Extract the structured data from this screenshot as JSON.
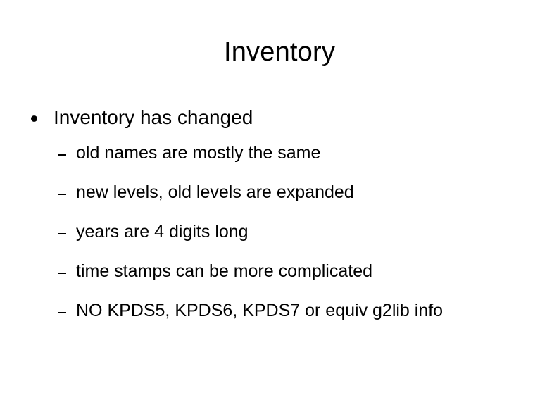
{
  "slide": {
    "title": "Inventory",
    "background_color": "#ffffff",
    "text_color": "#000000",
    "bullets": [
      {
        "marker": "disc-bullet-icon",
        "text": "Inventory has changed",
        "children": [
          {
            "marker": "dash-bullet-icon",
            "text": "old names are mostly the same"
          },
          {
            "marker": "dash-bullet-icon",
            "text": "new levels, old levels are expanded"
          },
          {
            "marker": "dash-bullet-icon",
            "text": "years are 4 digits long"
          },
          {
            "marker": "dash-bullet-icon",
            "text": "time stamps can be more complicated"
          },
          {
            "marker": "dash-bullet-icon",
            "text": "NO KPDS5, KPDS6, KPDS7 or equiv g2lib info"
          }
        ]
      }
    ]
  }
}
